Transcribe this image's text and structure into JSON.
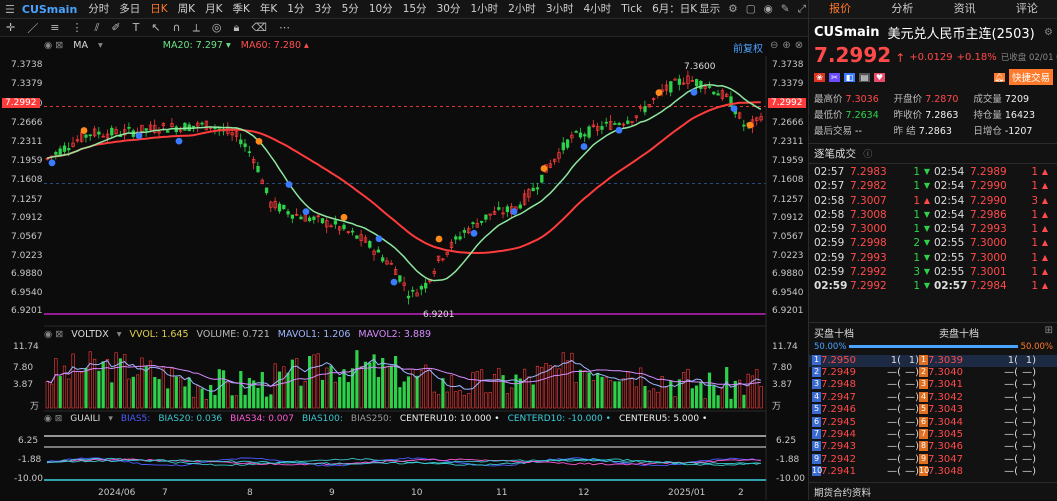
{
  "toolbar": {
    "symbol": "CUSmain",
    "periods": [
      "分时",
      "多日",
      "日K",
      "周K",
      "月K",
      "季K",
      "年K",
      "1分",
      "3分",
      "5分",
      "10分",
      "15分",
      "30分",
      "1小时",
      "2小时",
      "3小时",
      "4小时",
      "Tick",
      "6月：日K"
    ],
    "active_period": "日K",
    "display_label": "显示"
  },
  "ma_header": {
    "label": "MA",
    "ma20_label": "MA20:",
    "ma20_value": "7.297",
    "ma60_label": "MA60:",
    "ma60_value": "7.280",
    "restore_label": "前复权"
  },
  "price_axis": {
    "ticks": [
      "7.3738",
      "7.3379",
      "7.3020",
      "7.2666",
      "7.2311",
      "7.1959",
      "7.1608",
      "7.1257",
      "7.0912",
      "7.0567",
      "7.0223",
      "6.9880",
      "6.9540",
      "6.9201"
    ],
    "current_price_tag": "7.2992",
    "high_label": "7.3600",
    "low_label": "6.9201"
  },
  "volume_header": {
    "label": "VOLTDX",
    "vvol_label": "VVOL:",
    "vvol_value": "1.645",
    "volume_label": "VOLUME:",
    "volume_value": "0.721",
    "mavol1_label": "MAVOL1:",
    "mavol1_value": "1.206",
    "mavol2_label": "MAVOL2:",
    "mavol2_value": "3.889",
    "ticks": [
      "11.74",
      "7.80",
      "3.87",
      "万"
    ]
  },
  "guaili_header": {
    "label": "GUAILI",
    "bias5_label": "BIAS5:",
    "bias20_label": "BIAS20:",
    "bias20_value": "0.036",
    "bias34_label": "BIAS34:",
    "bias34_value": "0.007",
    "bias100_label": "BIAS100:",
    "bias250_label": "BIAS250:",
    "center10_label": "CENTERU10:",
    "center10_value": "10.000",
    "centerd10_label": "CENTERD10:",
    "centerd10_value": "-10.000",
    "center5_label": "CENTERU5:",
    "center5_value": "5.000",
    "ticks": [
      "6.25",
      "-1.88",
      "-10.00"
    ]
  },
  "time_axis": [
    "2024/06",
    "7",
    "8",
    "9",
    "10",
    "11",
    "12",
    "2025/01",
    "2"
  ],
  "chart_data": {
    "type": "candlestick",
    "x": [
      "2024-05",
      "2024-06",
      "2024-07",
      "2024-08",
      "2024-09",
      "2024-10",
      "2024-11",
      "2024-12",
      "2025-01",
      "2025-02"
    ],
    "close_approx": [
      7.2,
      7.25,
      7.26,
      7.14,
      6.98,
      7.05,
      7.18,
      7.28,
      7.33,
      7.2992
    ],
    "high": 7.36,
    "low": 6.9201,
    "ma20_last": 7.297,
    "ma60_last": 7.28,
    "ylim": [
      6.9201,
      7.3738
    ]
  },
  "panel": {
    "tabs": [
      "报价",
      "分析",
      "资讯",
      "评论"
    ],
    "title_symbol": "CUSmain",
    "title_name": "美元兑人民币主连(2503)",
    "price": "7.2992",
    "change": "+0.0129",
    "change_pct": "+0.18%",
    "close_note": "已收盘 02/01 02:59",
    "quick_trade": "快捷交易",
    "stats": [
      {
        "label": "最高价",
        "value": "7.3036",
        "color": "#ff4a4a"
      },
      {
        "label": "开盘价",
        "value": "7.2870",
        "color": "#ff4a4a"
      },
      {
        "label": "成交量",
        "value": "7209",
        "color": "#f0f0f0"
      },
      {
        "label": "最低价",
        "value": "7.2634",
        "color": "#2ed24a"
      },
      {
        "label": "昨收价",
        "value": "7.2863",
        "color": "#f0f0f0"
      },
      {
        "label": "持仓量",
        "value": "16423",
        "color": "#f0f0f0"
      },
      {
        "label": "最后交易",
        "value": "--",
        "color": "#f0f0f0"
      },
      {
        "label": "昨  结",
        "value": "7.2863",
        "color": "#f0f0f0"
      },
      {
        "label": "日增仓",
        "value": "-1207",
        "color": "#f0f0f0"
      }
    ],
    "trades_title": "逐笔成交",
    "trades_left": [
      {
        "t": "02:57",
        "p": "7.2983",
        "q": "1",
        "d": "down"
      },
      {
        "t": "02:57",
        "p": "7.2982",
        "q": "1",
        "d": "down"
      },
      {
        "t": "02:58",
        "p": "7.3007",
        "q": "1",
        "d": "up"
      },
      {
        "t": "02:58",
        "p": "7.3008",
        "q": "1",
        "d": "down"
      },
      {
        "t": "02:59",
        "p": "7.3000",
        "q": "1",
        "d": "down"
      },
      {
        "t": "02:59",
        "p": "7.2998",
        "q": "2",
        "d": "down"
      },
      {
        "t": "02:59",
        "p": "7.2993",
        "q": "1",
        "d": "down"
      },
      {
        "t": "02:59",
        "p": "7.2992",
        "q": "3",
        "d": "down"
      },
      {
        "t": "02:59",
        "p": "7.2992",
        "q": "1",
        "d": "down"
      }
    ],
    "trades_right": [
      {
        "t": "02:54",
        "p": "7.2989",
        "q": "1",
        "d": "up"
      },
      {
        "t": "02:54",
        "p": "7.2990",
        "q": "1",
        "d": "up"
      },
      {
        "t": "02:54",
        "p": "7.2990",
        "q": "3",
        "d": "up"
      },
      {
        "t": "02:54",
        "p": "7.2986",
        "q": "1",
        "d": "up"
      },
      {
        "t": "02:54",
        "p": "7.2993",
        "q": "1",
        "d": "up"
      },
      {
        "t": "02:55",
        "p": "7.3000",
        "q": "1",
        "d": "up"
      },
      {
        "t": "02:55",
        "p": "7.3000",
        "q": "1",
        "d": "up"
      },
      {
        "t": "02:55",
        "p": "7.3001",
        "q": "1",
        "d": "up"
      },
      {
        "t": "02:57",
        "p": "7.2984",
        "q": "1",
        "d": "up"
      }
    ],
    "book_buy_title": "买盘十档",
    "book_sell_title": "卖盘十档",
    "book_buy_pct": "50.00%",
    "book_sell_pct": "50.00%",
    "bids": [
      "7.2950",
      "7.2949",
      "7.2948",
      "7.2947",
      "7.2946",
      "7.2945",
      "7.2944",
      "7.2943",
      "7.2942",
      "7.2941"
    ],
    "asks": [
      "7.3039",
      "7.3040",
      "7.3041",
      "7.3042",
      "7.3043",
      "7.3044",
      "7.3045",
      "7.3046",
      "7.3047",
      "7.3048"
    ],
    "bid_first_qty": "1(",
    "bid_first_qty2": "1)",
    "ask_first_qty": "1(",
    "ask_first_qty2": "1)",
    "empty_qty": "—(",
    "empty_qty2": "—)",
    "footer": "期货合约资料"
  }
}
